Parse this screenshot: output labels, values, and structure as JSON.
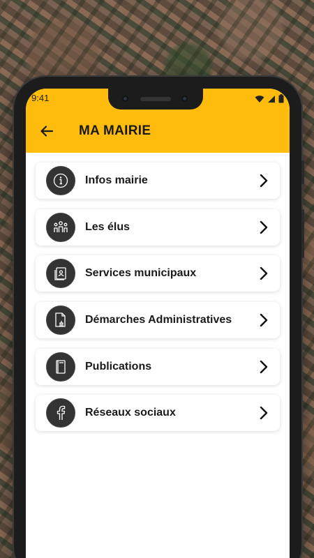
{
  "status_bar": {
    "time": "9:41",
    "icons": [
      "wifi-icon",
      "signal-icon",
      "battery-icon"
    ]
  },
  "header": {
    "title": "MA MAIRIE",
    "back_icon": "arrow-left-icon",
    "color": "#ffbc0d"
  },
  "menu": {
    "items": [
      {
        "label": "Infos mairie",
        "icon": "info-icon"
      },
      {
        "label": "Les élus",
        "icon": "people-icon"
      },
      {
        "label": "Services municipaux",
        "icon": "id-card-icon"
      },
      {
        "label": "Démarches Administratives",
        "icon": "document-stamp-icon"
      },
      {
        "label": "Publications",
        "icon": "book-icon"
      },
      {
        "label": "Réseaux sociaux",
        "icon": "facebook-icon"
      }
    ],
    "chevron_icon": "chevron-right-icon"
  }
}
